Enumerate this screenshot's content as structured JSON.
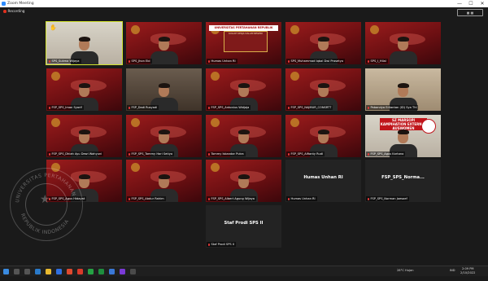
{
  "window": {
    "title": "Zoom Meeting",
    "minimize_glyph": "—",
    "maximize_glyph": "☐",
    "close_glyph": "✕"
  },
  "recording": {
    "label": "Recording"
  },
  "participants": [
    {
      "name": "SPS_Sukma Wijaya",
      "kind": "camera",
      "bg": "room",
      "active": true,
      "hand": "✋"
    },
    {
      "name": "SPS_Jhon Ebi",
      "kind": "camera",
      "bg": "ppt"
    },
    {
      "name": "Humas Unhan RI",
      "kind": "screen",
      "bg": "ppt",
      "banner": "UNIVERSITAS PERTAHANAN REPUBLIK INDONESIA",
      "slide": "KULIAH KERJA DALAM NEGERI"
    },
    {
      "name": "SPS_Muhammad Iqbal Dwi Prasetyo",
      "kind": "camera",
      "bg": "ppt"
    },
    {
      "name": "SPS_I_Hilal",
      "kind": "camera",
      "bg": "ppt"
    },
    {
      "name": "FSP_SPS_Iman Syarif",
      "kind": "camera",
      "bg": "ppt"
    },
    {
      "name": "FSP_Dadi Rusyadi",
      "kind": "camera",
      "bg": "room2"
    },
    {
      "name": "FSP_SPS_Antonius Widjaja",
      "kind": "camera",
      "bg": "ppt"
    },
    {
      "name": "FSP_SPS_NAJMUR_CONSRTT",
      "kind": "camera",
      "bg": "ppt"
    },
    {
      "name": "Pabandya Erliantan (ID) Sya Thl",
      "kind": "camera",
      "bg": "room3"
    },
    {
      "name": "FSP_SPS_Dhiah Ayu Dewi Wahyuni",
      "kind": "camera",
      "bg": "ppt"
    },
    {
      "name": "FSP_SPS_Tommy Hari Setiyo",
      "kind": "camera",
      "bg": "ppt"
    },
    {
      "name": "Tommy Iskandar Putra",
      "kind": "camera",
      "bg": "ppt"
    },
    {
      "name": "FSP_SPS_Alfianty Rudi",
      "kind": "camera",
      "bg": "ppt"
    },
    {
      "name": "FSP_SPS_Agus Kartono",
      "kind": "camera",
      "bg": "room",
      "sahuri": "SZ MARSOPI KAMPIHATION EXTERNAL AUSWOMEN"
    },
    {
      "name": "FSP_SPS_Agus Hidayat",
      "kind": "camera",
      "bg": "ppt"
    },
    {
      "name": "FSP_SPS_Abdur Rahim",
      "kind": "camera",
      "bg": "ppt"
    },
    {
      "name": "FSP_SPS_Albert Agung Wijaya",
      "kind": "camera",
      "bg": "ppt"
    },
    {
      "name": "Humas Unhan RI",
      "kind": "name",
      "display": "Humas Unhan RI"
    },
    {
      "name": "FSP_SPS_Norman Joesoef",
      "kind": "name",
      "display": "FSP_SPS_Norma..."
    },
    {
      "name": "Staf Prodi SPS II",
      "kind": "name",
      "display": "Staf Prodi SPS II"
    }
  ],
  "watermark": {
    "top_text": "UNIVERSITAS PERTAHANAN",
    "bottom_text": "REPUBLIK INDONESIA"
  },
  "taskbar": {
    "weather": "28°C  Hujan",
    "lang": "IND",
    "time": "2:09 PM",
    "date": "2/10/2022"
  },
  "colors": {
    "active_speaker_outline": "#d2e22e",
    "slide_red": "#9b1c1c",
    "gallery_bg": "#1a1a1a"
  }
}
